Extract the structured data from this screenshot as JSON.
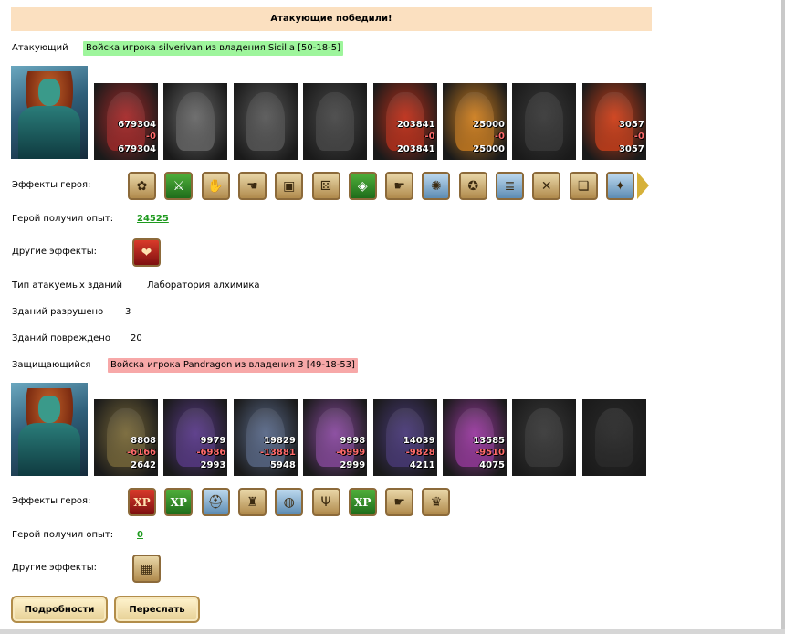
{
  "banner": "Атакующие победили!",
  "attacker": {
    "label": "Атакующий",
    "army": "Войска игрока silverivan из владения Sicilia [50-18-5]",
    "units": [
      {
        "name": "red-dragon-unit",
        "n1": "679304",
        "n2": "-0",
        "n3": "679304",
        "color": "#a82a2a"
      },
      {
        "name": "skeleton-unit",
        "n1": "",
        "n2": "",
        "n3": "",
        "color": "#6a6a6a"
      },
      {
        "name": "ghoul-unit",
        "n1": "",
        "n2": "",
        "n3": "",
        "color": "#5a5a5a"
      },
      {
        "name": "gargoyle-unit",
        "n1": "",
        "n2": "",
        "n3": "",
        "color": "#4a4a4a"
      },
      {
        "name": "fire-demon-unit",
        "n1": "203841",
        "n2": "-0",
        "n3": "203841",
        "color": "#c0301a"
      },
      {
        "name": "fire-monk-unit",
        "n1": "25000",
        "n2": "-0",
        "n3": "25000",
        "color": "#d08020"
      },
      {
        "name": "horned-knight-unit",
        "n1": "",
        "n2": "",
        "n3": "",
        "color": "#3a3a3a"
      },
      {
        "name": "flame-mage-unit",
        "n1": "3057",
        "n2": "-0",
        "n3": "3057",
        "color": "#d0401a"
      }
    ],
    "effects_label": "Эффекты героя:",
    "effects": [
      {
        "icon": "bag-icon",
        "glyph": "✿",
        "style": ""
      },
      {
        "icon": "sword-icon",
        "glyph": "⚔",
        "style": "green"
      },
      {
        "icon": "handshake-icon",
        "glyph": "✋",
        "style": ""
      },
      {
        "icon": "hand-icon",
        "glyph": "☚",
        "style": ""
      },
      {
        "icon": "chest-icon",
        "glyph": "▣",
        "style": ""
      },
      {
        "icon": "dice-icon",
        "glyph": "⚄",
        "style": ""
      },
      {
        "icon": "shield-icon",
        "glyph": "◈",
        "style": "green"
      },
      {
        "icon": "hand-shield-icon",
        "glyph": "☛",
        "style": ""
      },
      {
        "icon": "claw-icon",
        "glyph": "✺",
        "style": "blue"
      },
      {
        "icon": "pentagram-icon",
        "glyph": "✪",
        "style": ""
      },
      {
        "icon": "barrel-icon",
        "glyph": "≣",
        "style": "blue"
      },
      {
        "icon": "arrows-icon",
        "glyph": "✕",
        "style": ""
      },
      {
        "icon": "scroll-icon",
        "glyph": "❏",
        "style": ""
      },
      {
        "icon": "staff-icon",
        "glyph": "✦",
        "style": "blue"
      }
    ],
    "exp_label": "Герой получил опыт:",
    "exp_value": "24525",
    "other_label": "Другие эффекты:",
    "other_effects": [
      {
        "icon": "heart-sword-icon",
        "glyph": "❤",
        "style": "red"
      }
    ],
    "building_type_label": "Тип атакуемых зданий",
    "building_type_value": "Лаборатория алхимика",
    "destroyed_label": "Зданий разрушено",
    "destroyed_value": "3",
    "damaged_label": "Зданий повреждено",
    "damaged_value": "20"
  },
  "defender": {
    "label": "Защищающийся",
    "army": "Войска игрока Pandragon из владения 3 [49-18-53]",
    "units": [
      {
        "name": "ogre-unit",
        "n1": "8808",
        "n2": "-6166",
        "n3": "2642",
        "color": "#7a6a3a"
      },
      {
        "name": "rogue-unit",
        "n1": "9979",
        "n2": "-6986",
        "n3": "2993",
        "color": "#5a3a8a"
      },
      {
        "name": "lizard-warrior-unit",
        "n1": "19829",
        "n2": "-13881",
        "n3": "5948",
        "color": "#5a6a8a"
      },
      {
        "name": "harpy-unit",
        "n1": "9998",
        "n2": "-6999",
        "n3": "2999",
        "color": "#8a4aa0"
      },
      {
        "name": "elf-archer-unit",
        "n1": "14039",
        "n2": "-9828",
        "n3": "4211",
        "color": "#4a3a7a"
      },
      {
        "name": "sorceress-unit",
        "n1": "13585",
        "n2": "-9510",
        "n3": "4075",
        "color": "#9a3aa0"
      },
      {
        "name": "hooded-assassin-unit",
        "n1": "",
        "n2": "",
        "n3": "",
        "color": "#3a3a3a"
      },
      {
        "name": "spider-knight-unit",
        "n1": "",
        "n2": "",
        "n3": "",
        "color": "#2a2a2a"
      }
    ],
    "effects_label": "Эффекты героя:",
    "effects": [
      {
        "icon": "xp-red-icon",
        "glyph": "XP",
        "style": "red"
      },
      {
        "icon": "xp-book-icon",
        "glyph": "XP",
        "style": "green"
      },
      {
        "icon": "helmet-icon",
        "glyph": "⛑",
        "style": "blue"
      },
      {
        "icon": "tower-icon",
        "glyph": "♜",
        "style": ""
      },
      {
        "icon": "ring-icon",
        "glyph": "◍",
        "style": "blue"
      },
      {
        "icon": "trident-icon",
        "glyph": "Ψ",
        "style": ""
      },
      {
        "icon": "xp-green-icon",
        "glyph": "XP",
        "style": "green"
      },
      {
        "icon": "hand-shield-icon",
        "glyph": "☛",
        "style": ""
      },
      {
        "icon": "crest-icon",
        "glyph": "♛",
        "style": ""
      }
    ],
    "exp_label": "Герой получил опыт:",
    "exp_value": "0",
    "other_label": "Другие эффекты:",
    "other_effects": [
      {
        "icon": "barricade-icon",
        "glyph": "▦",
        "style": ""
      }
    ]
  },
  "buttons": {
    "details": "Подробности",
    "forward": "Переслать"
  }
}
